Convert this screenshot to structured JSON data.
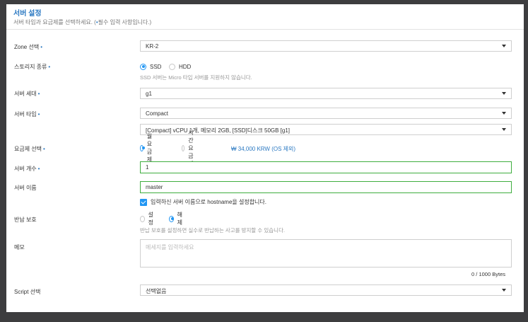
{
  "header": {
    "title": "서버 설정",
    "subtitle_prefix": "서버 타입과 요금제를 선택하세요. (",
    "subtitle_star": "•",
    "subtitle_suffix": "필수 입력 사항입니다.)"
  },
  "required_mark": "•",
  "zone": {
    "label": "Zone 선택",
    "value": "KR-2"
  },
  "storage": {
    "label": "스토리지 종류",
    "options": [
      "SSD",
      "HDD"
    ],
    "selected": "SSD",
    "hint": "SSD 서버는 Micro 타입 서버를 지원하지 않습니다."
  },
  "generation": {
    "label": "서버 세대",
    "value": "g1"
  },
  "server_type": {
    "label": "서버 타입",
    "value": "Compact",
    "spec_value": "[Compact] vCPU 1개, 메모리 2GB, [SSD]디스크 50GB [g1]"
  },
  "plan": {
    "label": "요금제 선택",
    "options": [
      "월요금제",
      "시간 요금제"
    ],
    "selected": "월요금제",
    "price": "₩ 34,000 KRW (OS 제외)"
  },
  "count": {
    "label": "서버 개수",
    "value": "1"
  },
  "name": {
    "label": "서버 이름",
    "value": "master",
    "checkbox_label": "입력하신 서버 이름으로 hostname을 설정합니다."
  },
  "protection": {
    "label": "반납 보호",
    "options": [
      "설정",
      "해제"
    ],
    "selected": "해제",
    "hint": "반납 보호를 설정하면 실수로 반납하는 사고를 방지할 수 있습니다."
  },
  "memo": {
    "label": "메모",
    "placeholder": "메세지를 입력하세요",
    "counter": "0 / 1000 Bytes"
  },
  "script": {
    "label": "Script 선택",
    "value": "선택없음"
  },
  "colors": {
    "accent": "#2196f3",
    "title": "#2b79c2",
    "valid_border": "#3fae3f"
  }
}
